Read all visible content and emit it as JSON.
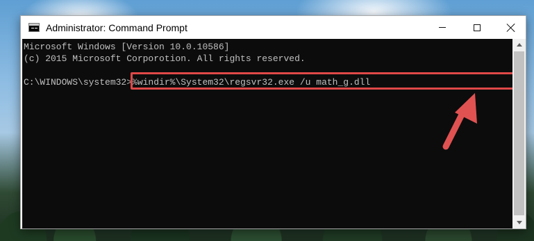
{
  "window": {
    "title": "Administrator: Command Prompt",
    "icon": "cmd-icon",
    "controls": {
      "minimize": "minimize-icon",
      "maximize": "maximize-icon",
      "close": "close-icon"
    }
  },
  "console": {
    "line1": "Microsoft Windows [Version 10.0.10586]",
    "line2": "(c) 2015 Microsoft Corporotion. All rights reserved.",
    "prompt": "C:\\WINDOWS\\system32>",
    "command": "%windir%\\System32\\regsvr32.exe /u math_g.dll"
  },
  "colors": {
    "console_bg": "#0c0c0c",
    "console_text": "#c0c0c0",
    "highlight": "#e04848"
  }
}
